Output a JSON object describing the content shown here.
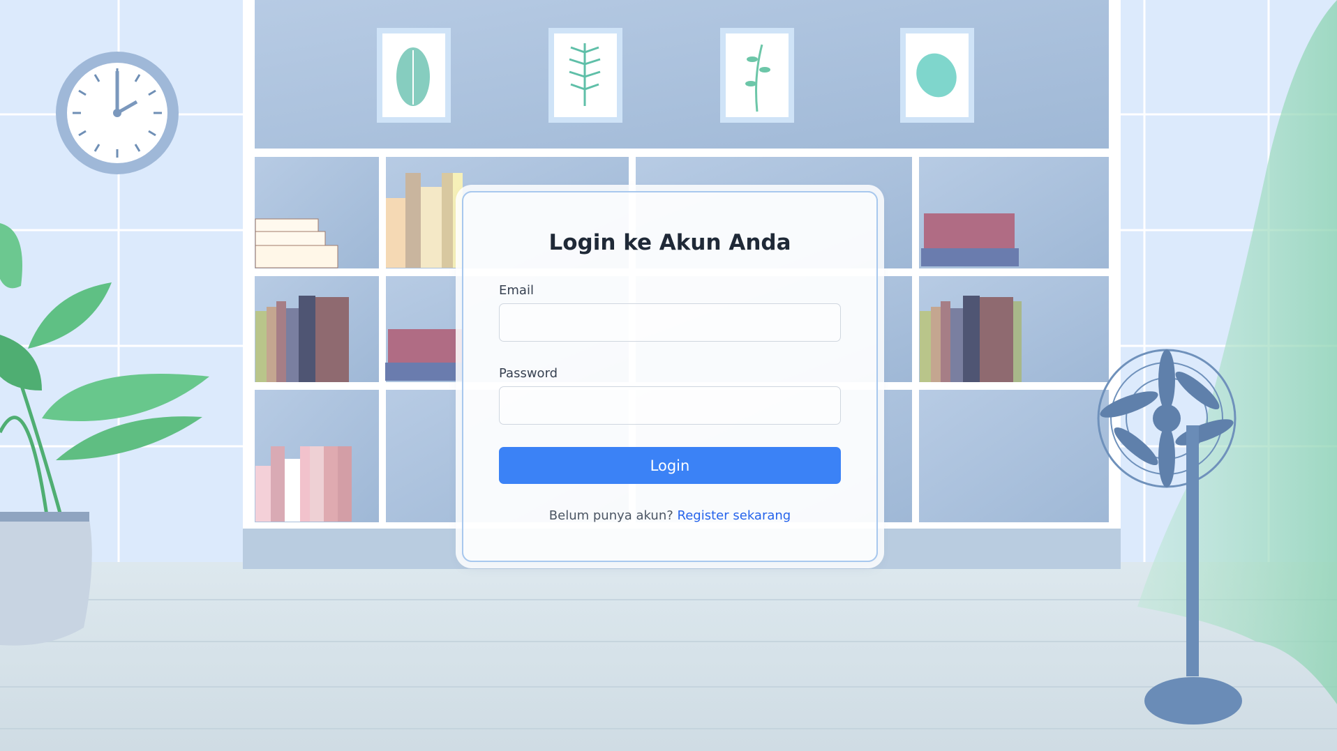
{
  "login": {
    "title": "Login ke Akun Anda",
    "email_label": "Email",
    "email_value": "",
    "password_label": "Password",
    "password_value": "",
    "button_label": "Login",
    "register_prompt": "Belum punya akun?",
    "register_link": "Register sekarang"
  },
  "colors": {
    "primary_button": "#3b82f6",
    "link": "#2563eb",
    "wall": "#dceafc",
    "shelf": "#a9c0dc",
    "floor": "#d6e3ea"
  },
  "icons": [
    "wall-clock-icon",
    "potted-plant-icon",
    "standing-fan-icon",
    "leaf-frame-icon",
    "fern-frame-icon",
    "sprig-frame-icon"
  ]
}
